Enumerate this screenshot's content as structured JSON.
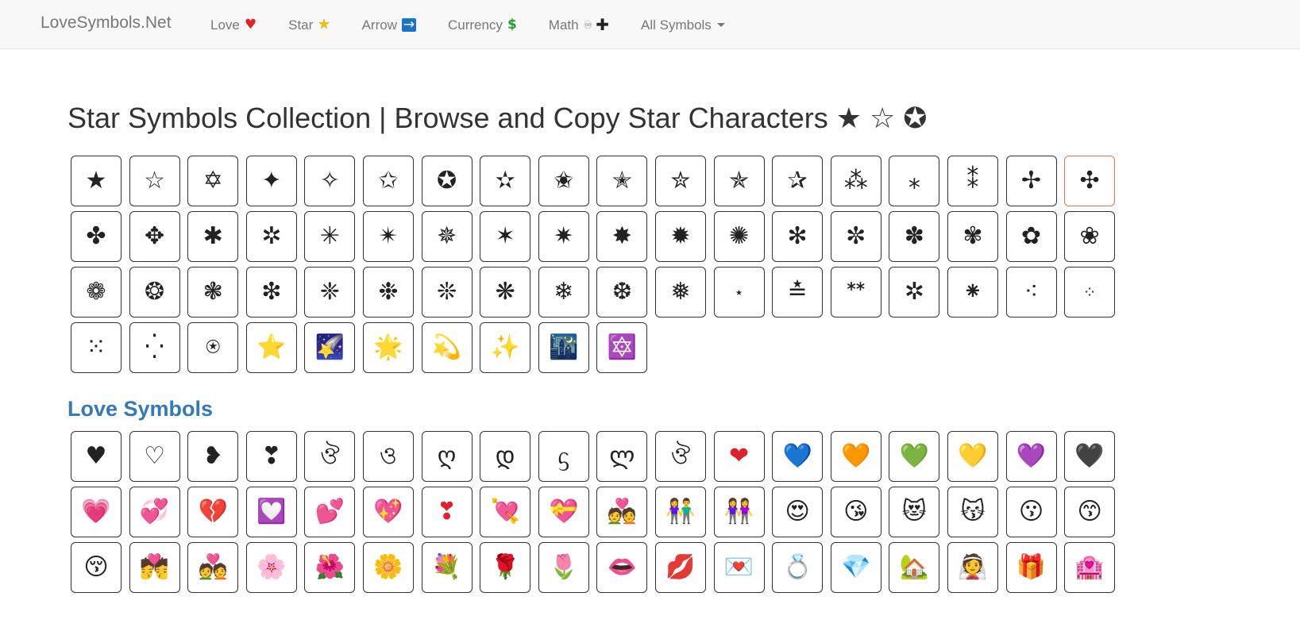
{
  "nav": {
    "brand": "LoveSymbols.Net",
    "links": [
      {
        "label": "Love",
        "icon": "♥"
      },
      {
        "label": "Star",
        "icon": "★"
      },
      {
        "label": "Arrow",
        "icon": "→"
      },
      {
        "label": "Currency",
        "icon": "$"
      },
      {
        "label": "Math",
        "icon_a": "♾",
        "icon_b": "✚"
      },
      {
        "label": "All Symbols"
      }
    ]
  },
  "page": {
    "title": "Star Symbols Collection | Browse and Copy Star Characters ★ ☆ ✪"
  },
  "star_symbols": [
    "★",
    "☆",
    "✡",
    "✦",
    "✧",
    "✩",
    "✪",
    "✫",
    "✬",
    "✭",
    "✮",
    "✯",
    "✰",
    "⁂",
    "⁎",
    "⁑",
    "✢",
    "✣",
    "✤",
    "✥",
    "✱",
    "✲",
    "✳",
    "✴",
    "✵",
    "✶",
    "✷",
    "✸",
    "✹",
    "✺",
    "✻",
    "✼",
    "✽",
    "✾",
    "✿",
    "❀",
    "❁",
    "❂",
    "❃",
    "❇",
    "❈",
    "❉",
    "❊",
    "❋",
    "❄",
    "❆",
    "❅",
    "⋆",
    "≛",
    "ᕯ",
    "✲",
    "⁕",
    "⁖",
    "⁘",
    "⁙",
    "⁛",
    "⍟",
    "⭐",
    "🌠",
    "🌟",
    "💫",
    "✨",
    "🌃",
    "🔯"
  ],
  "active_star_index": 17,
  "love_section": {
    "title": "Love Symbols"
  },
  "love_symbols": [
    "♥",
    "♡",
    "❥",
    "❣",
    "ঔ",
    "ও",
    "ღ",
    "დ",
    "ᦓ",
    "ლ",
    "ঔ",
    "❤",
    "💙",
    "🧡",
    "💚",
    "💛",
    "💜",
    "🖤",
    "💗",
    "💞",
    "💔",
    "💟",
    "💕",
    "💖",
    "❣",
    "💘",
    "💝",
    "💑",
    "👫",
    "👭",
    "😍",
    "😘",
    "😻",
    "😽",
    "😗",
    "😙",
    "😚",
    "💏",
    "💑",
    "🌸",
    "🌺",
    "🌼",
    "💐",
    "🌹",
    "🌷",
    "👄",
    "💋",
    "💌",
    "💍",
    "💎",
    "🏡",
    "👰",
    "🎁",
    "🏩"
  ],
  "colors": {
    "brand_text": "#777777",
    "section_title": "#337ab7",
    "active_border": "#e8704f",
    "navbar_bg": "#f8f8f8"
  }
}
